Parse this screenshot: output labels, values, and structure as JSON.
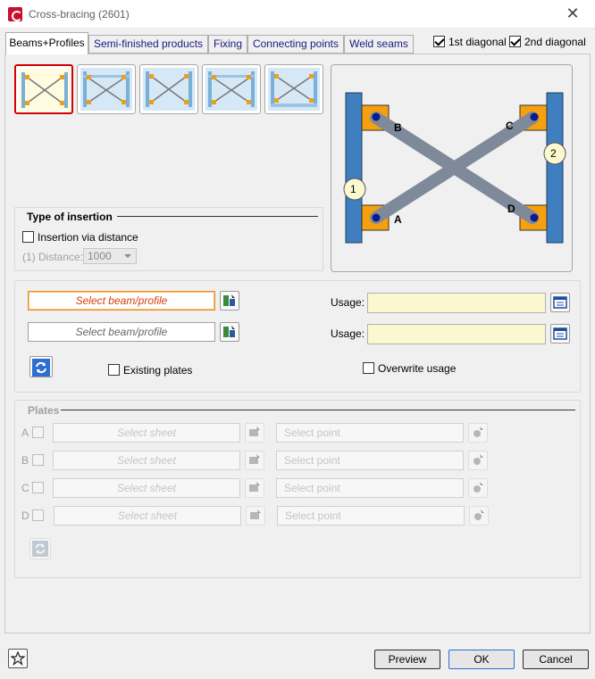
{
  "window": {
    "title": "Cross-bracing (2601)"
  },
  "tabs": [
    {
      "label": "Beams+Profiles"
    },
    {
      "label": "Semi-finished products"
    },
    {
      "label": "Fixing"
    },
    {
      "label": "Connecting points"
    },
    {
      "label": "Weld seams"
    }
  ],
  "diagonals": {
    "first_label": "1st diagonal",
    "second_label": "2nd diagonal",
    "first_checked": true,
    "second_checked": true
  },
  "preview": {
    "marker_1": "1",
    "marker_2": "2",
    "point_a": "A",
    "point_b": "B",
    "point_c": "C",
    "point_d": "D"
  },
  "insertion": {
    "title": "Type of insertion",
    "via_distance_label": "Insertion via distance",
    "distance_label": "(1) Distance:",
    "distance_value": "1000"
  },
  "beams": {
    "select_1": "Select beam/profile",
    "select_2": "Select beam/profile",
    "usage_label_1": "Usage:",
    "usage_label_2": "Usage:",
    "existing_plates_label": "Existing plates",
    "overwrite_usage_label": "Overwrite usage"
  },
  "plates": {
    "title": "Plates",
    "rows": [
      {
        "letter": "A",
        "sheet": "Select sheet",
        "point": "Select point"
      },
      {
        "letter": "B",
        "sheet": "Select sheet",
        "point": "Select point"
      },
      {
        "letter": "C",
        "sheet": "Select sheet",
        "point": "Select point"
      },
      {
        "letter": "D",
        "sheet": "Select sheet",
        "point": "Select point"
      }
    ]
  },
  "footer": {
    "preview_label": "Preview",
    "ok_label": "OK",
    "cancel_label": "Cancel"
  },
  "colors": {
    "column": "#3f7fbf",
    "plate": "#f5a00e",
    "brace": "#7e8a99",
    "selected_border": "#d40000",
    "field_orange": "#f08c1a",
    "usage_bg": "#fbf8cf"
  }
}
